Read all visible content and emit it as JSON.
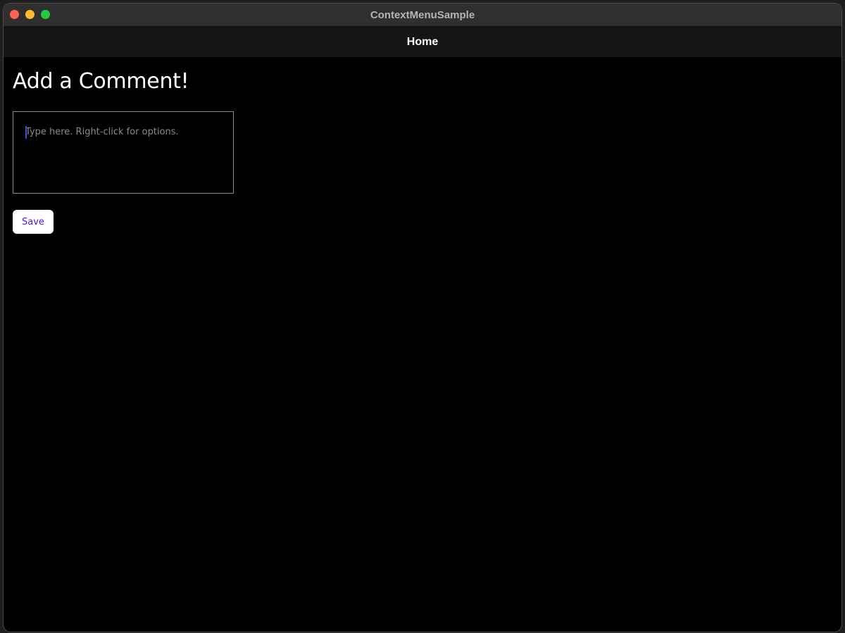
{
  "window": {
    "title": "ContextMenuSample"
  },
  "navbar": {
    "title": "Home"
  },
  "page": {
    "heading": "Add a Comment!",
    "editor": {
      "placeholder": "Type here. Right-click for options.",
      "value": ""
    },
    "save_label": "Save"
  },
  "colors": {
    "background": "#000000",
    "navbar": "#151515",
    "titlebar": "#2f2f2f",
    "button_text": "#4b17c7",
    "button_bg": "#ffffff",
    "caret": "#3b4fd8"
  }
}
